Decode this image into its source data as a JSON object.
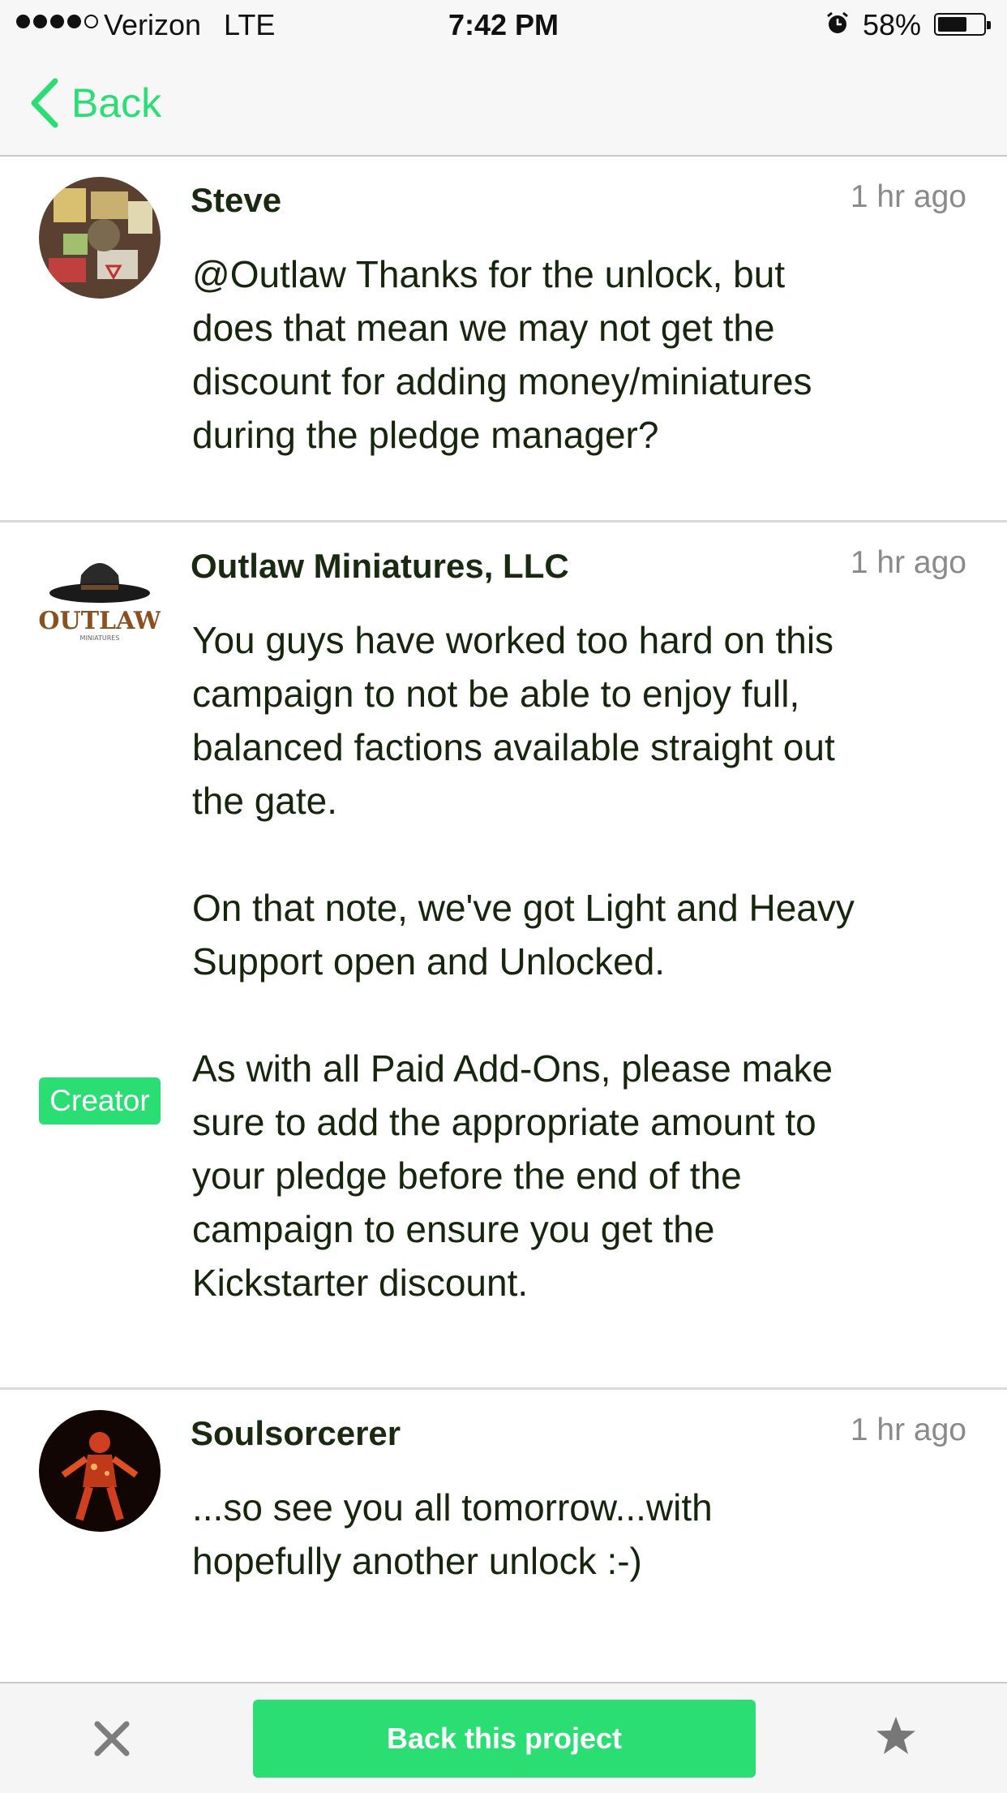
{
  "status_bar": {
    "carrier": "Verizon",
    "network": "LTE",
    "time": "7:42 PM",
    "battery_percent": "58%",
    "battery_level": 0.58,
    "signal_bars": 4,
    "signal_bars_max": 5
  },
  "nav": {
    "back_label": "Back",
    "accent_color": "#2bde73"
  },
  "comments": [
    {
      "author": "Steve",
      "time_ago": "1 hr ago",
      "body": "@Outlaw Thanks for the unlock, but\ndoes that mean we may not get the\ndiscount for adding money/miniatures\nduring the pledge manager?"
    },
    {
      "author": "Outlaw Miniatures, LLC",
      "time_ago": "1 hr ago",
      "badge": "Creator",
      "body": "You guys have worked too hard on this\ncampaign to not be able to enjoy full,\nbalanced factions available straight out\nthe gate.\n\nOn that note, we've got Light and Heavy\nSupport open and Unlocked.\n\nAs with all Paid Add-Ons, please make\nsure to add the appropriate amount to\nyour pledge before the end of the\ncampaign to ensure you get the\nKickstarter discount."
    },
    {
      "author": "Soulsorcerer",
      "time_ago": "1 hr ago",
      "body": "...so see you all tomorrow...with\nhopefully another unlock :-)"
    }
  ],
  "bottom_bar": {
    "cta_label": "Back this project",
    "close_icon": "close-icon",
    "star_icon": "star-icon"
  }
}
